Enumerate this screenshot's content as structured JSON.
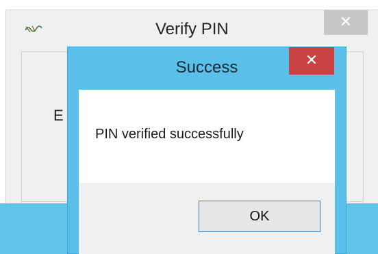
{
  "background_window": {
    "title": "Verify PIN",
    "close_glyph": "✕",
    "partial_label": "E",
    "app_icon": "app-logo-icon"
  },
  "dialog": {
    "title": "Success",
    "close_glyph": "✕",
    "message": "PIN verified successfully",
    "ok_label": "OK"
  },
  "colors": {
    "dialog_frame": "#5bc0e9",
    "close_red": "#c94345",
    "ok_border": "#3c7fb1"
  }
}
